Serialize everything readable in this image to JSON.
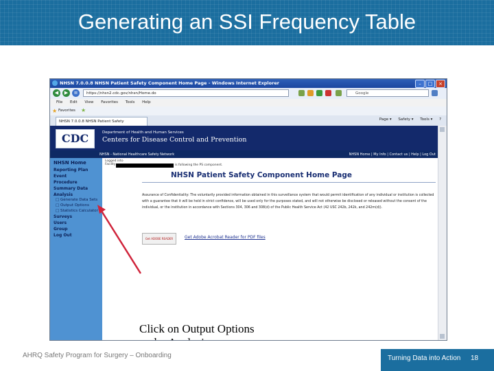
{
  "slide": {
    "title": "Generating an SSI Frequency Table",
    "footer_left": "AHRQ Safety Program for Surgery – Onboarding",
    "footer_right": "Turning Data into Action",
    "page_number": "18",
    "annotation": "Click on Output Options\nunder Analysis"
  },
  "browser": {
    "title": "NHSN 7.0.0.8 NHSN Patient Safety Component Home Page - Windows Internet Explorer",
    "url": "https://nhsn2.cdc.gov/nhsn/Home.do",
    "search_placeholder": "Google",
    "menu": [
      "File",
      "Edit",
      "View",
      "Favorites",
      "Tools",
      "Help"
    ],
    "favorites_label": "Favorites",
    "tab_label": "NHSN 7.0.0.8 NHSN Patient Safety Component Home",
    "tools": [
      "Page ▾",
      "Safety ▾",
      "Tools ▾",
      "?"
    ]
  },
  "cdc": {
    "logo": "CDC",
    "dept": "Department of Health and Human Services",
    "centers": "Centers for Disease Control and Prevention",
    "nhsn_bar": "NHSN - National Healthcare Safety Network",
    "top_links": "NHSN Home | My Info | Contact us | Help | Log Out"
  },
  "nav": {
    "items": [
      "NHSN Home",
      "Reporting Plan",
      "Event",
      "Procedure",
      "Summary Data",
      "Analysis",
      "Surveys",
      "Users",
      "Group",
      "Log Out"
    ],
    "analysis_sub": [
      "Generate Data Sets",
      "Output Options",
      "Statistics Calculator"
    ]
  },
  "page": {
    "logged_into": "Logged into",
    "facility": "Facility",
    "following": "is following the PS component.",
    "heading": "NHSN Patient Safety Component Home Page",
    "assurance": "Assurance of Confidentiality: The voluntarily provided information obtained in this surveillance system that would permit identification of any individual or institution is collected with a guarantee that it will be held in strict confidence, will be used only for the purposes stated, and will not otherwise be disclosed or released without the consent of the individual, or the institution in accordance with Sections 304, 306 and 308(d) of the Public Health Service Act (42 USC 242b, 242k, and 242m(d)).",
    "pdf_icon_label": "Get ADOBE READER",
    "pdf_link": "Get Adobe Acrobat Reader for PDF files"
  },
  "colors": {
    "header_blue": "#1b6e9f",
    "cdc_navy": "#13296b",
    "nav_blue": "#4f92d2",
    "arrow_red": "#d0243b"
  }
}
